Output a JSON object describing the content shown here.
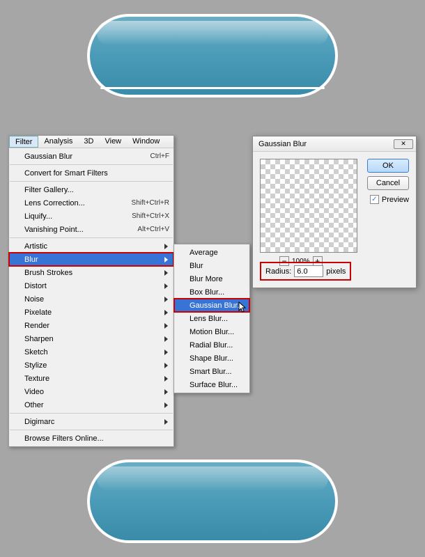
{
  "menubar": {
    "filter": "Filter",
    "analysis": "Analysis",
    "view3d": "3D",
    "view": "View",
    "window": "Window"
  },
  "menu": {
    "gaussian_blur": "Gaussian Blur",
    "gaussian_blur_sc": "Ctrl+F",
    "convert_sf": "Convert for Smart Filters",
    "filter_gallery": "Filter Gallery...",
    "lens_correction": "Lens Correction...",
    "lens_correction_sc": "Shift+Ctrl+R",
    "liquify": "Liquify...",
    "liquify_sc": "Shift+Ctrl+X",
    "vanishing_point": "Vanishing Point...",
    "vanishing_point_sc": "Alt+Ctrl+V",
    "artistic": "Artistic",
    "blur": "Blur",
    "brush_strokes": "Brush Strokes",
    "distort": "Distort",
    "noise": "Noise",
    "pixelate": "Pixelate",
    "render": "Render",
    "sharpen": "Sharpen",
    "sketch": "Sketch",
    "stylize": "Stylize",
    "texture": "Texture",
    "video": "Video",
    "other": "Other",
    "digimarc": "Digimarc",
    "browse": "Browse Filters Online..."
  },
  "submenu": {
    "average": "Average",
    "blur": "Blur",
    "blur_more": "Blur More",
    "box_blur": "Box Blur...",
    "gaussian_blur": "Gaussian Blur...",
    "lens_blur": "Lens Blur...",
    "motion_blur": "Motion Blur...",
    "radial_blur": "Radial Blur...",
    "shape_blur": "Shape Blur...",
    "smart_blur": "Smart Blur...",
    "surface_blur": "Surface Blur..."
  },
  "dialog": {
    "title": "Gaussian Blur",
    "ok": "OK",
    "cancel": "Cancel",
    "preview": "Preview",
    "zoom": "100%",
    "radius_label": "Radius:",
    "radius_value": "6.0",
    "radius_unit": "pixels",
    "close": "✕",
    "check": "✓",
    "minus": "−",
    "plus": "+"
  }
}
